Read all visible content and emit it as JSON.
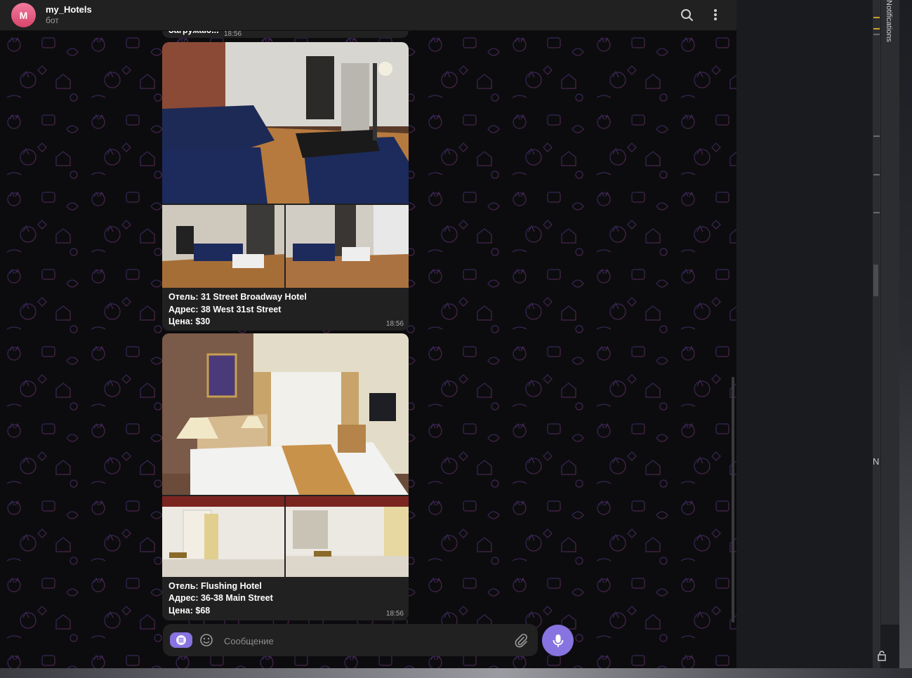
{
  "chat": {
    "avatar_letter": "M",
    "title": "my_Hotels",
    "subtitle": "бот"
  },
  "messages": {
    "loading_text": "Загружаю...",
    "loading_time": "18:56",
    "hotels": [
      {
        "name_line": "Отель: 31 Street Broadway Hotel",
        "address_line": "Адрес: 38 West 31st Street",
        "price_line": "Цена: $30",
        "time": "18:56"
      },
      {
        "name_line": "Отель: Flushing Hotel",
        "address_line": "Адрес: 36-38 Main Street",
        "price_line": "Цена: $68",
        "time": "18:56"
      }
    ]
  },
  "composer": {
    "placeholder": "Сообщение"
  },
  "ide": {
    "notifications_label": "Notifications",
    "n_fragment": "N"
  },
  "colors": {
    "accent": "#8774e1",
    "bubble": "#212121",
    "header": "#212121",
    "avatar": "#e8587e"
  }
}
